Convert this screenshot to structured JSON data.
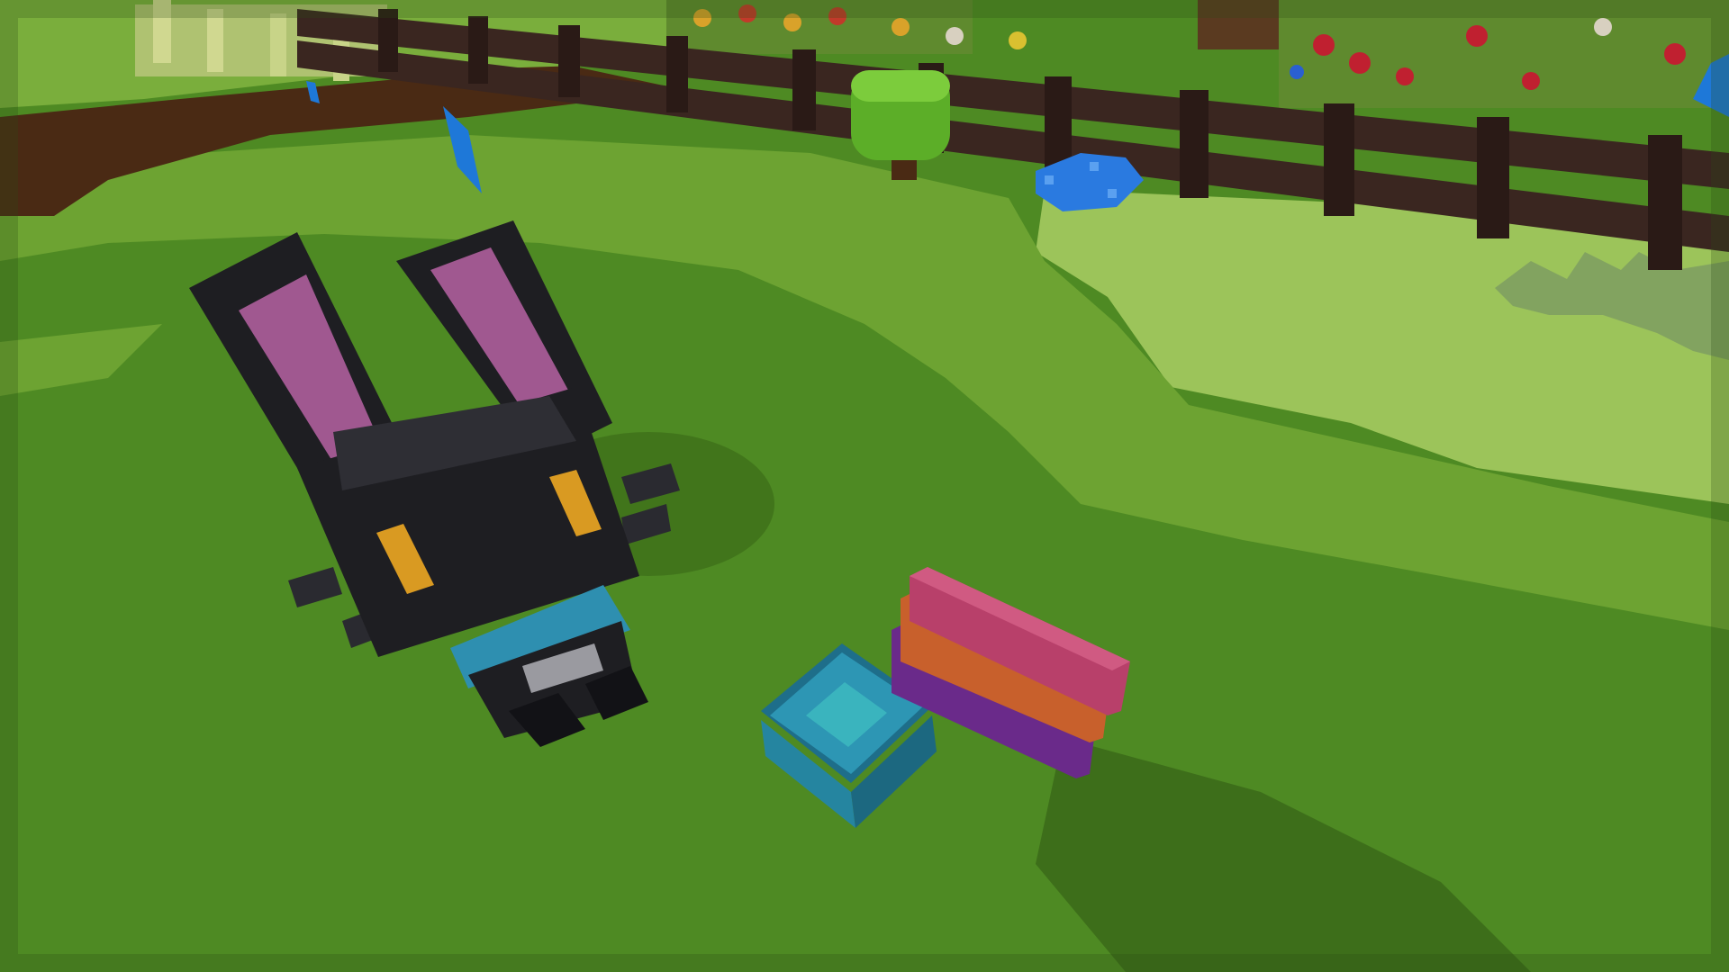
{
  "game": {
    "scene": "voxel-garden-field",
    "hud_visible": false
  },
  "colors": {
    "grass_dark": "#4e8a23",
    "grass_mid": "#5d9a2c",
    "grass_light": "#86b544",
    "grass_pale": "#9cc45a",
    "soil": "#4a2a14",
    "fence": "#3a2620",
    "fence_shadow": "#2a1a16",
    "bunny_body": "#1e1e22",
    "bunny_ear_inner": "#a05890",
    "bunny_eye": "#d99a22",
    "bunny_scarf": "#2e8fb0",
    "bowl": "#2d96b4",
    "bowl_water": "#3ab4be",
    "stack_pink": "#b8406a",
    "stack_orange": "#c8602c",
    "stack_purple": "#6a2a8a",
    "bush": "#5cae28",
    "blue_flowers": "#2a7ae0",
    "marker": "#1e78d8"
  },
  "objects": [
    {
      "name": "player-bunny",
      "kind": "character",
      "icon": "black-rabbit"
    },
    {
      "name": "water-bowl",
      "kind": "placeable",
      "icon": "blue-bowl"
    },
    {
      "name": "colored-block-stack",
      "kind": "placeable",
      "icon": "striped-blocks"
    },
    {
      "name": "round-bush",
      "kind": "decoration",
      "icon": "bush"
    },
    {
      "name": "wooden-fence",
      "kind": "structure",
      "icon": "fence"
    },
    {
      "name": "blue-flower-patch",
      "kind": "decoration",
      "icon": "flowers"
    },
    {
      "name": "blue-waypoint-marker",
      "kind": "marker",
      "icon": "diamond-marker"
    }
  ]
}
